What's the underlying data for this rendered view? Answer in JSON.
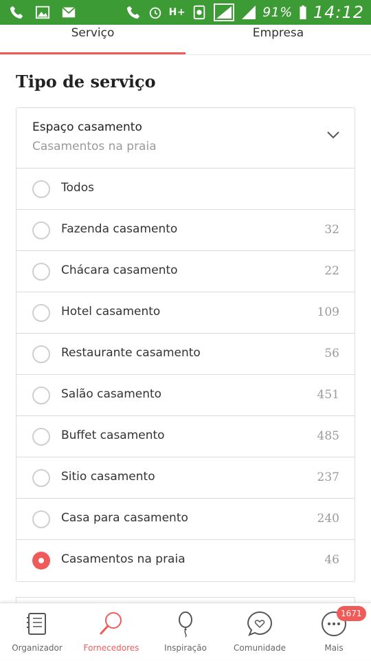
{
  "status_bar": {
    "battery": "91%",
    "time": "14:12",
    "network": "H+",
    "icons": [
      "phone-icon",
      "image-icon",
      "mail-icon",
      "call-icon",
      "alarm-icon",
      "network-icon",
      "data-icon",
      "signal-icon",
      "signal-2-icon",
      "battery-icon"
    ]
  },
  "tabs": [
    {
      "label": "Serviço",
      "active": true
    },
    {
      "label": "Empresa",
      "active": false
    }
  ],
  "section_title": "Tipo de serviço",
  "filter": {
    "title": "Espaço casamento",
    "subtitle": "Casamentos na praia"
  },
  "options": [
    {
      "label": "Todos",
      "count": "",
      "selected": false
    },
    {
      "label": "Fazenda casamento",
      "count": "32",
      "selected": false
    },
    {
      "label": "Chácara casamento",
      "count": "22",
      "selected": false
    },
    {
      "label": "Hotel casamento",
      "count": "109",
      "selected": false
    },
    {
      "label": "Restaurante casamento",
      "count": "56",
      "selected": false
    },
    {
      "label": "Salão casamento",
      "count": "451",
      "selected": false
    },
    {
      "label": "Buffet casamento",
      "count": "485",
      "selected": false
    },
    {
      "label": "Sitio casamento",
      "count": "237",
      "selected": false
    },
    {
      "label": "Casa para casamento",
      "count": "240",
      "selected": false
    },
    {
      "label": "Casamentos na praia",
      "count": "46",
      "selected": true
    }
  ],
  "bottom_nav": [
    {
      "label": "Organizador",
      "icon": "planner-icon",
      "active": false
    },
    {
      "label": "Fornecedores",
      "icon": "search-icon",
      "active": true
    },
    {
      "label": "Inspiração",
      "icon": "balloon-icon",
      "active": false
    },
    {
      "label": "Comunidade",
      "icon": "chat-heart-icon",
      "active": false
    },
    {
      "label": "Mais",
      "icon": "more-icon",
      "active": false,
      "badge": "1671"
    }
  ],
  "colors": {
    "status_bar": "#3d9b35",
    "accent": "#ef5b59",
    "border": "#dcdcdc"
  }
}
